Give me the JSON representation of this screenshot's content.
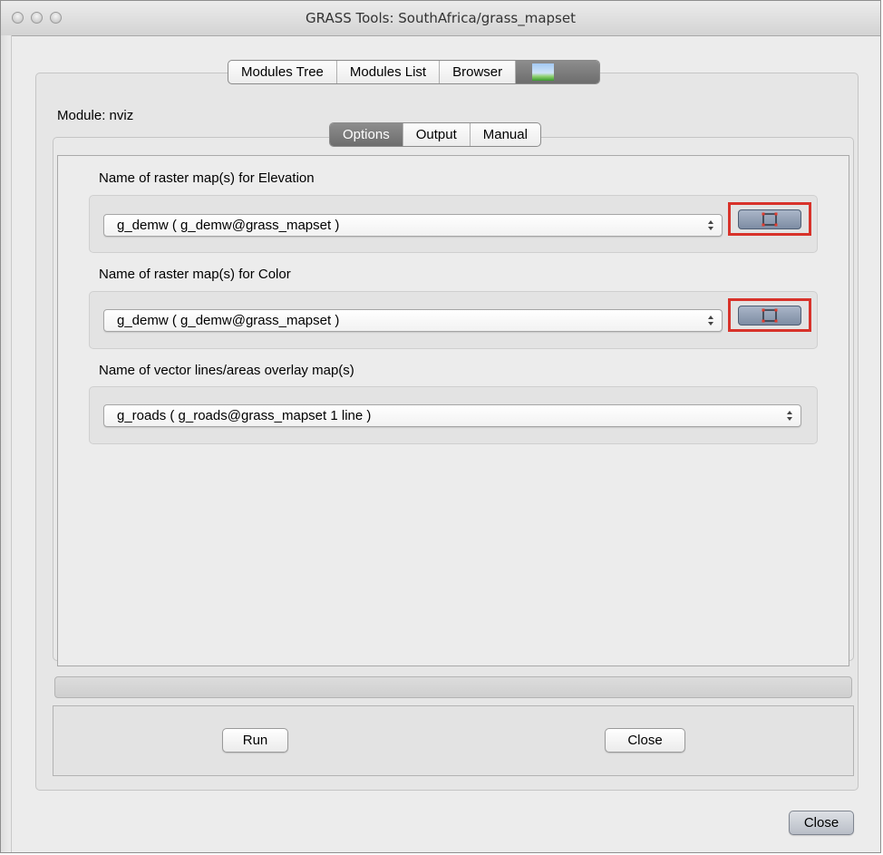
{
  "window": {
    "title": "GRASS Tools: SouthAfrica/grass_mapset"
  },
  "main_tabs": [
    {
      "label": "Modules Tree"
    },
    {
      "label": "Modules List"
    },
    {
      "label": "Browser"
    },
    {
      "label": "",
      "icon": "map-thumbnail-icon"
    }
  ],
  "module": {
    "label": "Module: nviz"
  },
  "sub_tabs": [
    {
      "label": "Options",
      "selected": true
    },
    {
      "label": "Output"
    },
    {
      "label": "Manual"
    }
  ],
  "fields": [
    {
      "label": "Name of raster map(s) for Elevation",
      "value": "g_demw ( g_demw@grass_mapset )",
      "select_icon": "select-on-map-icon"
    },
    {
      "label": "Name of raster map(s) for Color",
      "value": "g_demw ( g_demw@grass_mapset )",
      "select_icon": "select-on-map-icon"
    },
    {
      "label": "Name of vector lines/areas overlay map(s)",
      "value": "g_roads ( g_roads@grass_mapset 1 line )"
    }
  ],
  "progress": {
    "value": 0
  },
  "buttons": {
    "run": "Run",
    "close_inner": "Close",
    "close_outer": "Close"
  },
  "colors": {
    "highlight": "#d8322a",
    "selected_tab": "#7a7a7a"
  }
}
